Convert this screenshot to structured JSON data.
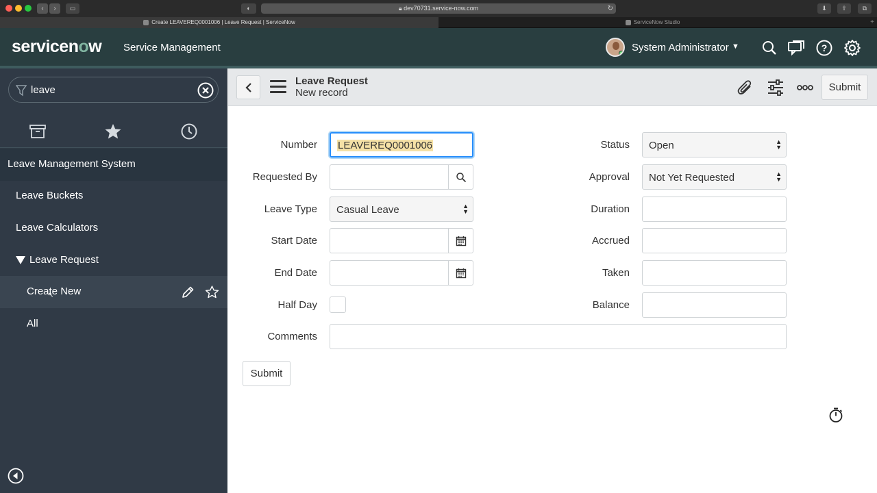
{
  "browser": {
    "url": "dev70731.service-now.com",
    "tabs": [
      {
        "label": "Create LEAVEREQ0001006 | Leave Request | ServiceNow"
      },
      {
        "label": "ServiceNow Studio"
      }
    ]
  },
  "header": {
    "logo_text": "servicenow",
    "product": "Service Management",
    "user_name": "System Administrator",
    "icons": [
      "search-icon",
      "chat-icon",
      "help-icon",
      "gear-icon"
    ]
  },
  "nav": {
    "filter_value": "leave",
    "tabs": [
      "archive-icon",
      "star-icon",
      "history-icon"
    ],
    "application": "Leave Management System",
    "modules": [
      {
        "label": "Leave Buckets"
      },
      {
        "label": "Leave Calculators"
      },
      {
        "label": "Leave Request",
        "expanded": true
      }
    ],
    "submodules": [
      {
        "label": "Create New",
        "active": true
      },
      {
        "label": "All"
      }
    ]
  },
  "form": {
    "title": "Leave Request",
    "subtitle": "New record",
    "header_submit": "Submit",
    "submit": "Submit",
    "left": {
      "number_label": "Number",
      "number_value": "LEAVEREQ0001006",
      "requested_by_label": "Requested By",
      "requested_by_value": "",
      "leave_type_label": "Leave Type",
      "leave_type_value": "Casual Leave",
      "start_date_label": "Start Date",
      "start_date_value": "",
      "end_date_label": "End Date",
      "end_date_value": "",
      "half_day_label": "Half Day",
      "half_day_checked": false,
      "comments_label": "Comments",
      "comments_value": ""
    },
    "right": {
      "status_label": "Status",
      "status_value": "Open",
      "approval_label": "Approval",
      "approval_value": "Not Yet Requested",
      "duration_label": "Duration",
      "duration_value": "",
      "accrued_label": "Accrued",
      "accrued_value": "",
      "taken_label": "Taken",
      "taken_value": "",
      "balance_label": "Balance",
      "balance_value": ""
    }
  },
  "colors": {
    "header_bg": "#293e40",
    "nav_bg": "#303a46",
    "focus": "#278efc",
    "logo_accent": "#81b5a1"
  }
}
